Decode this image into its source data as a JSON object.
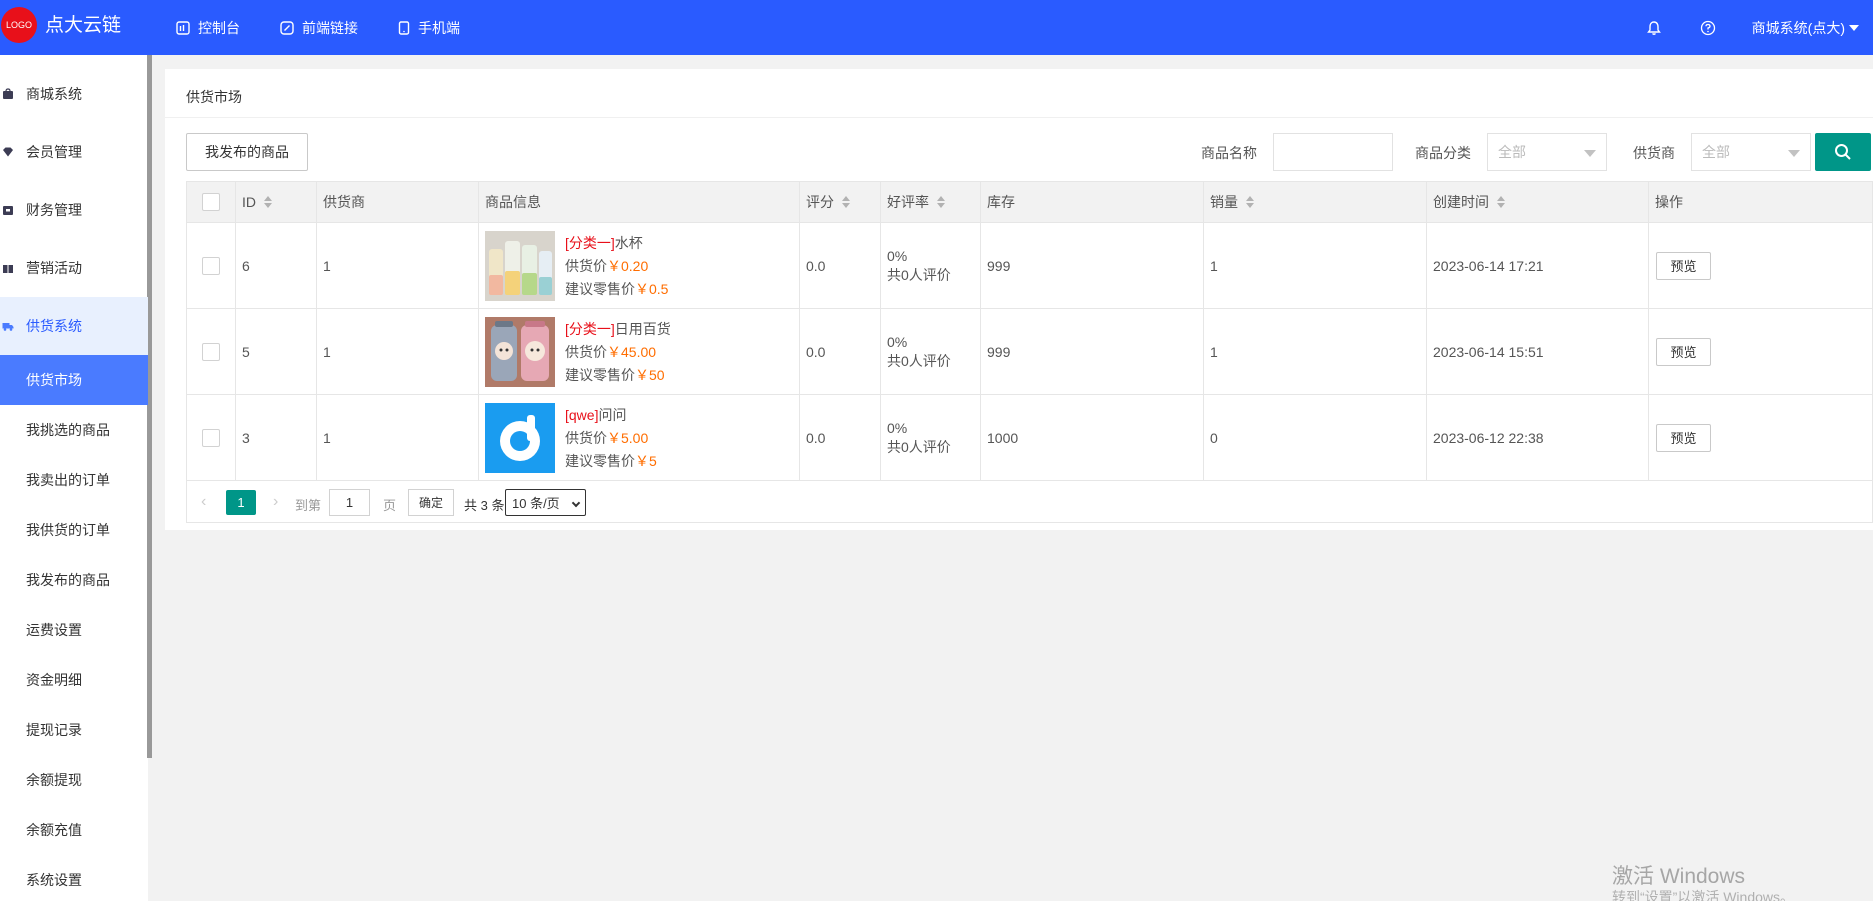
{
  "header": {
    "logo_badge": "LOGO",
    "brand": "点大云链",
    "nav": [
      "控制台",
      "前端链接",
      "手机端"
    ],
    "user": "商城系统(点大)"
  },
  "sidebar": {
    "items": [
      "商城系统",
      "会员管理",
      "财务管理",
      "营销活动",
      "供货系统"
    ],
    "subitems": [
      "供货市场",
      "我挑选的商品",
      "我卖出的订单",
      "我供货的订单",
      "我发布的商品",
      "运费设置",
      "资金明细",
      "提现记录",
      "余额提现",
      "余额充值",
      "系统设置"
    ]
  },
  "panel": {
    "title": "供货市场",
    "my_goods_button": "我发布的商品",
    "filter_name_label": "商品名称",
    "filter_category_label": "商品分类",
    "filter_category_value": "全部",
    "filter_supplier_label": "供货商",
    "filter_supplier_value": "全部"
  },
  "table": {
    "headers": [
      "ID",
      "供货商",
      "商品信息",
      "评分",
      "好评率",
      "库存",
      "销量",
      "创建时间",
      "操作"
    ],
    "price_label": "供货价",
    "retail_label": "建议零售价",
    "preview_label": "预览",
    "rows": [
      {
        "id": "6",
        "supplier": "1",
        "tag": "[分类一]",
        "name": "水杯",
        "price": "￥0.20",
        "retail": "￥0.5",
        "score": "0.0",
        "rate": "0%",
        "rate_count": "共0人评价",
        "stock": "999",
        "sales": "1",
        "created": "2023-06-14 17:21"
      },
      {
        "id": "5",
        "supplier": "1",
        "tag": "[分类一]",
        "name": "日用百货",
        "price": "￥45.00",
        "retail": "￥50",
        "score": "0.0",
        "rate": "0%",
        "rate_count": "共0人评价",
        "stock": "999",
        "sales": "1",
        "created": "2023-06-14 15:51"
      },
      {
        "id": "3",
        "supplier": "1",
        "tag": "[qwe]",
        "name": "问问",
        "price": "￥5.00",
        "retail": "￥5",
        "score": "0.0",
        "rate": "0%",
        "rate_count": "共0人评价",
        "stock": "1000",
        "sales": "0",
        "created": "2023-06-12 22:38"
      }
    ]
  },
  "pager": {
    "current": "1",
    "goto_label": "到第",
    "page_input": "1",
    "page_unit": "页",
    "ok": "确定",
    "total": "共 3 条",
    "size": "10 条/页"
  },
  "watermark": {
    "line1": "激活 Windows",
    "line2": "转到“设置”以激活 Windows。"
  },
  "colors": {
    "header": "#2a5bff",
    "accent_green": "#009688",
    "red": "#e8101a",
    "orange": "#ff6d00"
  }
}
